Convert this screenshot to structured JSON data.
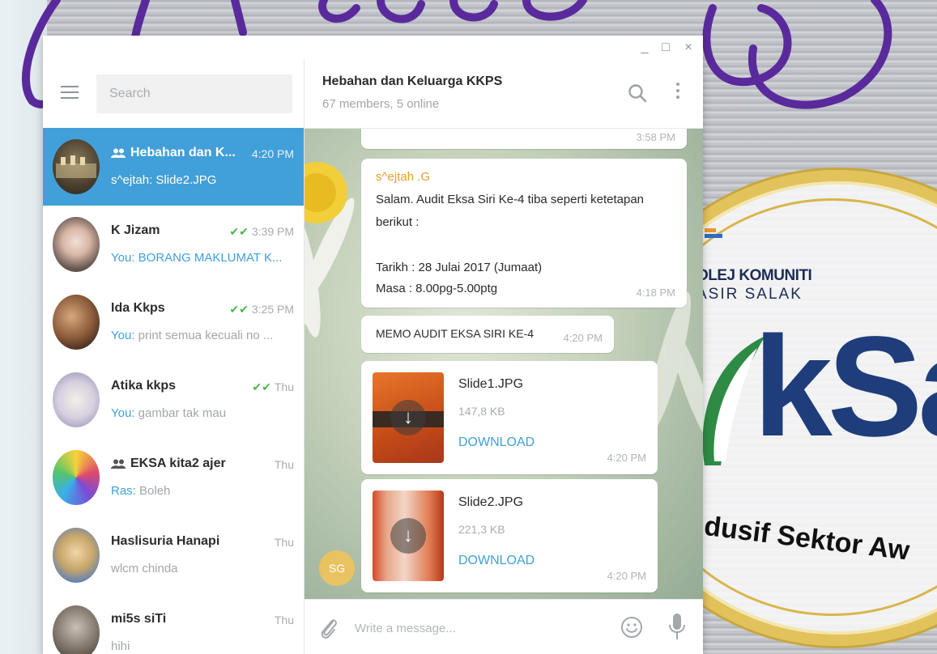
{
  "window": {
    "controls": [
      "_",
      "□",
      "×"
    ]
  },
  "sidebar": {
    "search_placeholder": "Search",
    "chats": [
      {
        "name": "Hebahan dan K...",
        "time": "4:20 PM",
        "preview_prefix": "",
        "preview": "s^ejtah: Slide2.JPG",
        "group": true,
        "read": false,
        "active": true
      },
      {
        "name": "K Jizam",
        "time": "3:39 PM",
        "preview_prefix": "You:",
        "preview": "BORANG MAKLUMAT K...",
        "group": false,
        "read": true,
        "active": false
      },
      {
        "name": "Ida Kkps",
        "time": "3:25 PM",
        "preview_prefix": "You:",
        "preview": "print semua kecuali no ...",
        "group": false,
        "read": true,
        "active": false
      },
      {
        "name": "Atika kkps",
        "time": "Thu",
        "preview_prefix": "You:",
        "preview": "gambar tak mau",
        "group": false,
        "read": true,
        "active": false
      },
      {
        "name": "EKSA kita2 ajer",
        "time": "Thu",
        "preview_prefix": "Ras:",
        "preview": "Boleh",
        "group": true,
        "read": false,
        "active": false
      },
      {
        "name": "Haslisuria Hanapi",
        "time": "Thu",
        "preview_prefix": "",
        "preview": "wlcm chinda",
        "group": false,
        "read": false,
        "active": false
      },
      {
        "name": "mi5s siTi",
        "time": "Thu",
        "preview_prefix": "",
        "preview": "hihi",
        "group": false,
        "read": false,
        "active": false
      }
    ]
  },
  "conversation": {
    "title": "Hebahan dan Keluarga KKPS",
    "subtitle": "67 members, 5 online",
    "messages": {
      "prev_time": "3:58 PM",
      "text_msg": {
        "author": "s^ejtah .G",
        "lines": [
          "Salam. Audit Eksa Siri Ke-4 tiba seperti ketetapan",
          "berikut :",
          "",
          "Tarikh : 28 Julai 2017 (Jumaat)",
          "Masa : 8.00pg-5.00ptg"
        ],
        "time": "4:18 PM"
      },
      "memo": {
        "text": "MEMO AUDIT EKSA SIRI KE-4",
        "time": "4:20 PM"
      },
      "files": [
        {
          "name": "Slide1.JPG",
          "size": "147,8 KB",
          "action": "DOWNLOAD",
          "time": "4:20 PM"
        },
        {
          "name": "Slide2.JPG",
          "size": "221,3 KB",
          "action": "DOWNLOAD",
          "time": "4:20 PM"
        }
      ],
      "sender_initials": "SG"
    },
    "composer_placeholder": "Write a message..."
  },
  "poster": {
    "org_line1": "OLEJ KOMUNITI",
    "org_line2": "ASIR SALAK",
    "brand": "kSa",
    "tagline": "ndusif Sektor Aw"
  },
  "colors": {
    "accent": "#419fd9",
    "author": "#e39f2a",
    "read_check": "#4fb44f",
    "swirl": "#5a2a9c",
    "brand": "#1f3d7a"
  }
}
